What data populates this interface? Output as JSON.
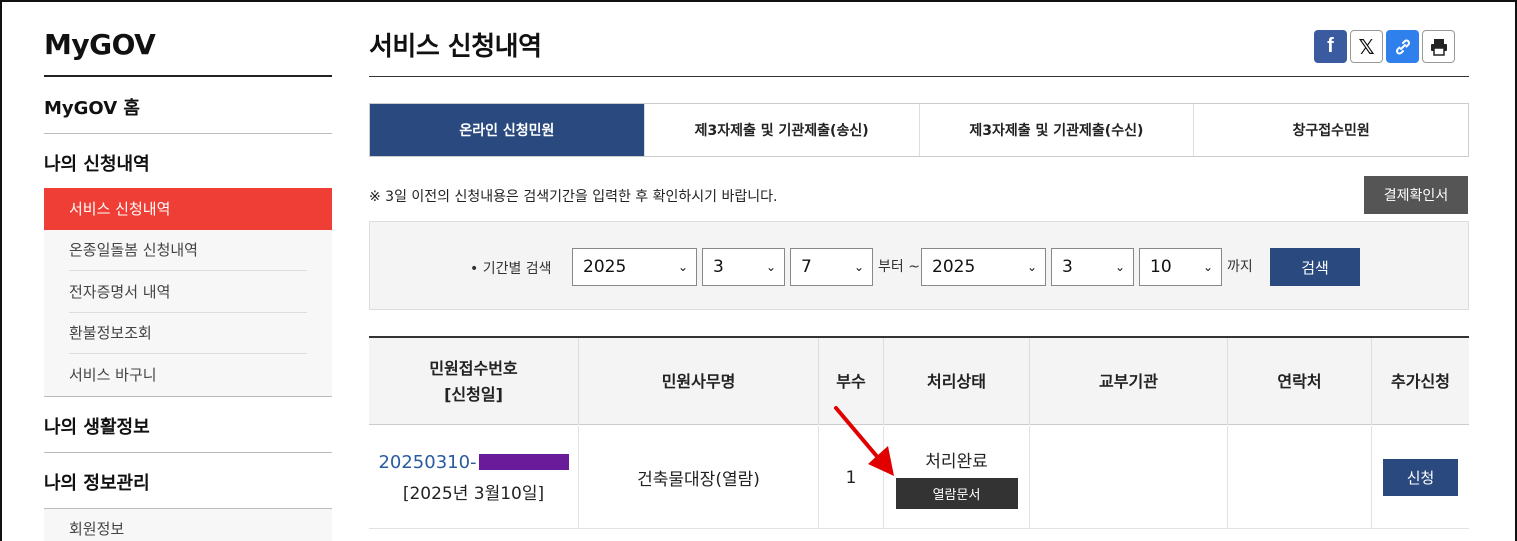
{
  "sidebar": {
    "brand": "MyGOV",
    "items": [
      {
        "label": "MyGOV 홈"
      },
      {
        "label": "나의 신청내역"
      },
      {
        "label": "나의 생활정보"
      },
      {
        "label": "나의 정보관리"
      }
    ],
    "sub_items": [
      {
        "label": "서비스 신청내역",
        "active": true
      },
      {
        "label": "온종일돌봄 신청내역"
      },
      {
        "label": "전자증명서 내역"
      },
      {
        "label": "환불정보조회"
      },
      {
        "label": "서비스 바구니"
      }
    ],
    "sub_items2": [
      {
        "label": "회원정보"
      }
    ]
  },
  "page": {
    "title": "서비스 신청내역",
    "share_icons": [
      "facebook-icon",
      "x-icon",
      "link-icon",
      "print-icon"
    ]
  },
  "tabs": [
    {
      "label": "온라인 신청민원",
      "active": true
    },
    {
      "label": "제3자제출 및 기관제출(송신)"
    },
    {
      "label": "제3자제출 및 기관제출(수신)"
    },
    {
      "label": "창구접수민원"
    }
  ],
  "notice": "※ 3일 이전의 신청내용은 검색기간을 입력한 후 확인하시기 바랍니다.",
  "pay_button": "결제확인서",
  "search": {
    "label": "• 기간별 검색",
    "from_year": "2025",
    "from_month": "3",
    "from_day": "7",
    "from_suffix": "부터 ~",
    "to_year": "2025",
    "to_month": "3",
    "to_day": "10",
    "to_suffix": "까지",
    "button": "검색"
  },
  "table": {
    "headers": [
      "민원접수번호",
      "[신청일]",
      "민원사무명",
      "부수",
      "처리상태",
      "교부기관",
      "연락처",
      "추가신청"
    ],
    "rows": [
      {
        "receipt_prefix": "20250310-",
        "apply_date": "[2025년 3월10일]",
        "service_name": "건축물대장(열람)",
        "copies": "1",
        "status": "처리완료",
        "open_doc": "열람문서",
        "issuing_org": "",
        "contact": "",
        "apply_button": "신청"
      }
    ]
  },
  "colors": {
    "accent_red": "#ef3e36",
    "navy": "#2a4a7f",
    "redaction": "#6a1b9a",
    "arrow": "#e00000"
  }
}
